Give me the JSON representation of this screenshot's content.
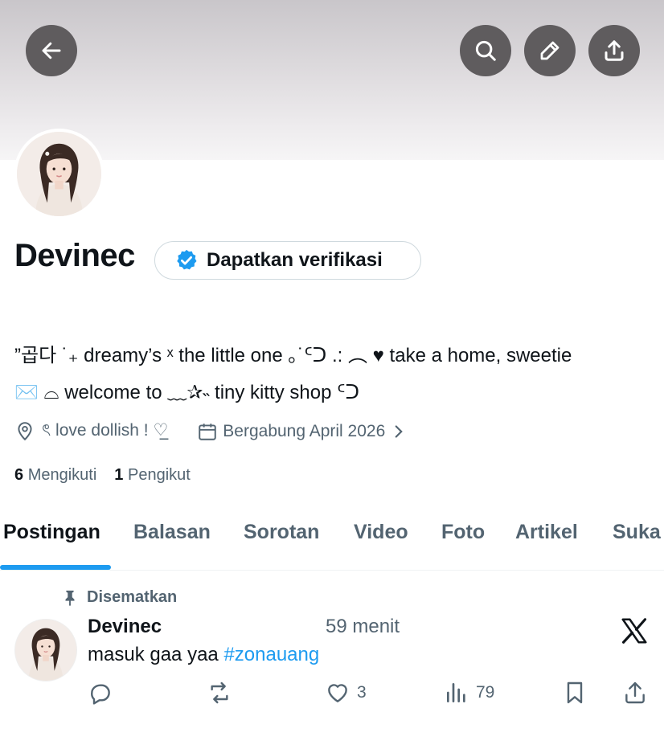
{
  "header": {
    "back_icon": "arrow-left-icon",
    "search_icon": "search-icon",
    "edit_icon": "pencil-icon",
    "share_icon": "share-icon"
  },
  "profile": {
    "name": "Devinec",
    "verify_label": "Dapatkan verifikasi",
    "bio_line1": "”곱다 ˙₊ dreamy’s ˣ the little one ｡˙ᑦᑐ .: ︵ ♥ take a home, sweetie",
    "bio_line2": "✉️ ⌓ welcome to ﹏✰˵ tiny kitty shop ᑦᑐ",
    "location": "ৎ love dollish ! ♡̲",
    "joined": "Bergabung April 2026",
    "following_count": "6",
    "following_label": "Mengikuti",
    "followers_count": "1",
    "followers_label": "Pengikut"
  },
  "tabs": [
    "Postingan",
    "Balasan",
    "Sorotan",
    "Video",
    "Foto",
    "Artikel",
    "Suka"
  ],
  "post": {
    "pinned_label": "Disematkan",
    "author": "Devinec",
    "time": "59 menit",
    "text": "masuk gaa yaa ",
    "hashtag": "#zonauang",
    "likes": "3",
    "views": "79"
  },
  "colors": {
    "accent": "#1d9bf0",
    "muted": "#536471",
    "text": "#0f1419",
    "header_button": "#5f5c5e"
  }
}
